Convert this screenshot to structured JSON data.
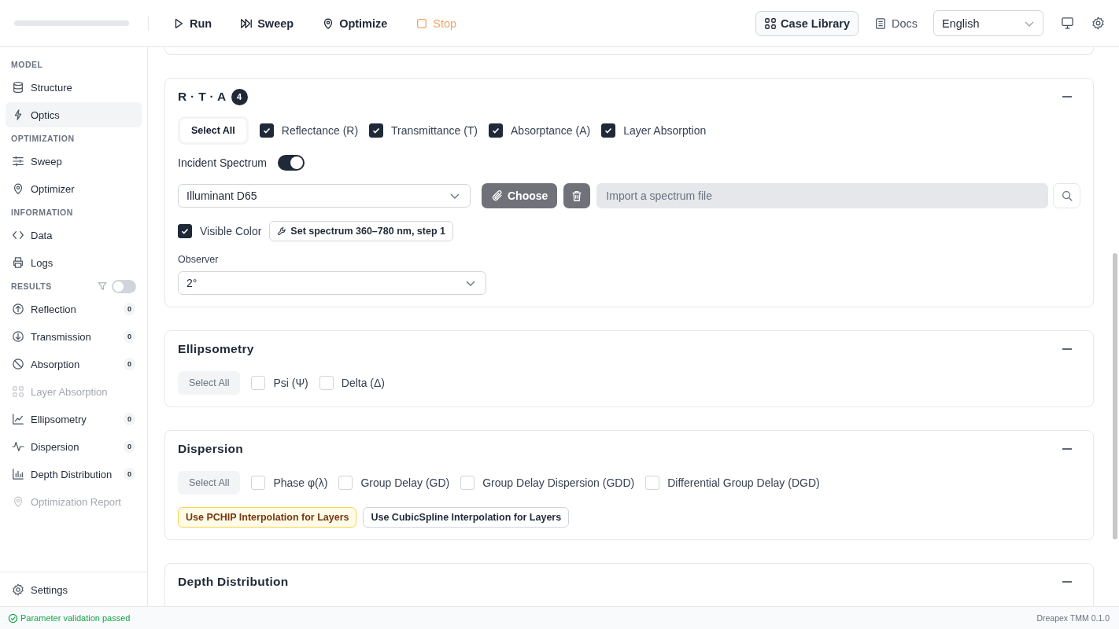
{
  "toolbar": {
    "actions": [
      {
        "label": "Run",
        "kind": "run"
      },
      {
        "label": "Sweep",
        "kind": "sweep"
      },
      {
        "label": "Optimize",
        "kind": "optimize"
      },
      {
        "label": "Stop",
        "kind": "stop"
      }
    ],
    "case_library": "Case Library",
    "docs": "Docs",
    "language": "English"
  },
  "sidebar": {
    "sections": [
      {
        "heading": "MODEL",
        "items": [
          {
            "label": "Structure",
            "selected": false,
            "disabled": false
          },
          {
            "label": "Optics",
            "selected": true,
            "disabled": false
          }
        ]
      },
      {
        "heading": "OPTIMIZATION",
        "items": [
          {
            "label": "Sweep",
            "selected": false,
            "disabled": false
          },
          {
            "label": "Optimizer",
            "selected": false,
            "disabled": false
          }
        ]
      },
      {
        "heading": "INFORMATION",
        "items": [
          {
            "label": "Data",
            "selected": false,
            "disabled": false
          },
          {
            "label": "Logs",
            "selected": false,
            "disabled": false
          }
        ]
      },
      {
        "heading": "RESULTS",
        "filter_on": false,
        "items": [
          {
            "label": "Reflection",
            "count": "0",
            "selected": false,
            "disabled": false
          },
          {
            "label": "Transmission",
            "count": "0",
            "selected": false,
            "disabled": false
          },
          {
            "label": "Absorption",
            "count": "0",
            "selected": false,
            "disabled": false
          },
          {
            "label": "Layer Absorption",
            "selected": false,
            "disabled": true
          },
          {
            "label": "Ellipsometry",
            "count": "0",
            "selected": false,
            "disabled": false
          },
          {
            "label": "Dispersion",
            "count": "0",
            "selected": false,
            "disabled": false
          },
          {
            "label": "Depth Distribution",
            "count": "0",
            "selected": false,
            "disabled": false
          },
          {
            "label": "Optimization Report",
            "selected": false,
            "disabled": true
          }
        ]
      }
    ],
    "footer_item": "Settings"
  },
  "cards": [
    {
      "title": "R · T · A",
      "badge": "4",
      "select_all": {
        "label": "Select All",
        "active": true
      },
      "options": [
        {
          "label": "Reflectance (R)",
          "checked": true
        },
        {
          "label": "Transmittance (T)",
          "checked": true
        },
        {
          "label": "Absorptance (A)",
          "checked": true
        },
        {
          "label": "Layer Absorption",
          "checked": true
        }
      ],
      "spectrum": {
        "label": "Incident Spectrum",
        "on": true,
        "source": "Illuminant D65",
        "choose": "Choose",
        "file_placeholder": "Import a spectrum file",
        "visible_color": {
          "label": "Visible Color",
          "checked": true
        },
        "set_button": "Set spectrum 360–780 nm, step 1",
        "observer_label": "Observer",
        "observer": "2°"
      }
    },
    {
      "title": "Ellipsometry",
      "select_all": {
        "label": "Select All",
        "active": false
      },
      "options": [
        {
          "label": "Psi (Ψ)",
          "checked": false
        },
        {
          "label": "Delta (Δ)",
          "checked": false
        }
      ]
    },
    {
      "title": "Dispersion",
      "select_all": {
        "label": "Select All",
        "active": false
      },
      "options": [
        {
          "label": "Phase φ(λ)",
          "checked": false
        },
        {
          "label": "Group Delay (GD)",
          "checked": false
        },
        {
          "label": "Group Delay Dispersion (GDD)",
          "checked": false
        },
        {
          "label": "Differential Group Delay (DGD)",
          "checked": false
        }
      ],
      "interpolation": [
        {
          "label": "Use PCHIP Interpolation for Layers",
          "selected": true
        },
        {
          "label": "Use CubicSpline Interpolation for Layers",
          "selected": false
        }
      ]
    },
    {
      "title": "Depth Distribution"
    }
  ],
  "status_bar": {
    "message": "Parameter validation passed",
    "version": "Dreapex TMM 0.1.0"
  }
}
